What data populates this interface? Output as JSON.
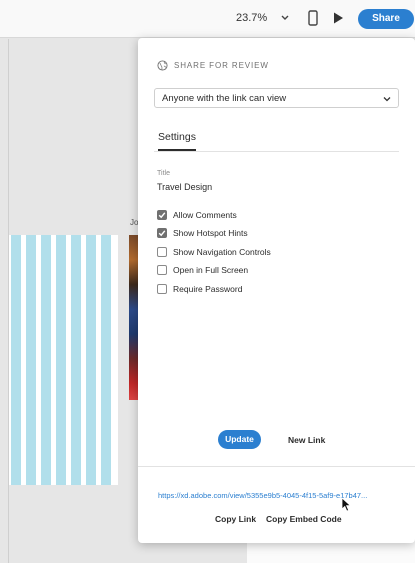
{
  "toolbar": {
    "zoom_level": "23.7%",
    "zoom_menu_icon": "chevron-down-icon",
    "device_preview_icon": "phone-icon",
    "play_icon": "play-icon",
    "share_label": "Share",
    "accent": "#2b7fd0"
  },
  "canvas": {
    "artboard_label": "Jo",
    "grid_color": "#b1dfeb",
    "grid_columns": 7
  },
  "share_panel": {
    "header_icon": "globe-icon",
    "header": "SHARE FOR REVIEW",
    "access_selected": "Anyone with the link can view",
    "access_menu_icon": "chevron-down-icon",
    "tab": "Settings",
    "title_label": "Title",
    "title_value": "Travel Design",
    "options": [
      {
        "label": "Allow Comments",
        "checked": true
      },
      {
        "label": "Show Hotspot Hints",
        "checked": true
      },
      {
        "label": "Show Navigation Controls",
        "checked": false
      },
      {
        "label": "Open in Full Screen",
        "checked": false
      },
      {
        "label": "Require Password",
        "checked": false
      }
    ],
    "update_label": "Update",
    "new_link_label": "New Link",
    "url": "https://xd.adobe.com/view/5355e9b5-4045-4f15-5af9-e17b47...",
    "copy_link_label": "Copy Link",
    "copy_embed_label": "Copy Embed Code"
  }
}
